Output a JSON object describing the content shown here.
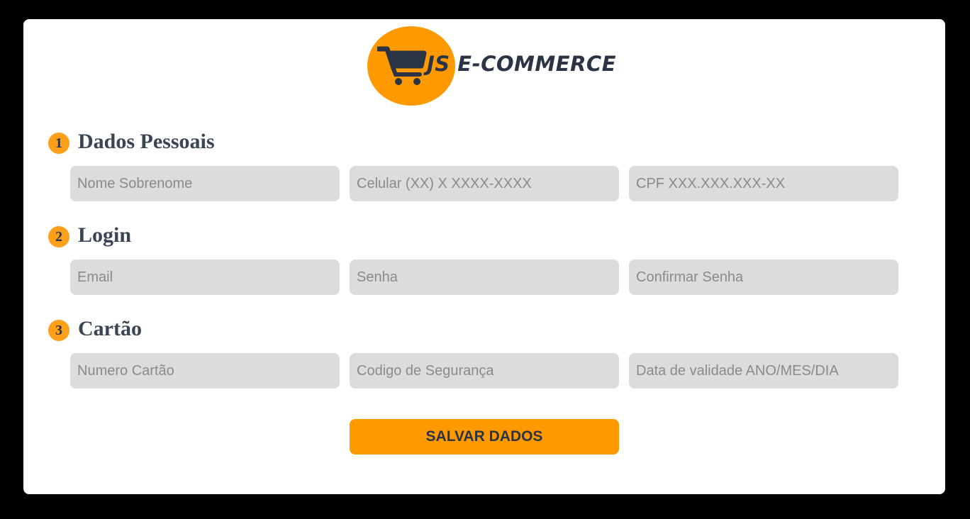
{
  "logo": {
    "text": "JS E-COMMERCE",
    "icon": "shopping-cart-icon",
    "circle_color": "#ff9900",
    "text_color": "#2a3444"
  },
  "sections": [
    {
      "number": "1",
      "title": "Dados Pessoais",
      "fields": [
        {
          "placeholder": "Nome Sobrenome",
          "value": ""
        },
        {
          "placeholder": "Celular (XX) X XXXX-XXXX",
          "value": ""
        },
        {
          "placeholder": "CPF XXX.XXX.XXX-XX",
          "value": ""
        }
      ]
    },
    {
      "number": "2",
      "title": "Login",
      "fields": [
        {
          "placeholder": "Email",
          "value": ""
        },
        {
          "placeholder": "Senha",
          "value": ""
        },
        {
          "placeholder": "Confirmar Senha",
          "value": ""
        }
      ]
    },
    {
      "number": "3",
      "title": "Cartão",
      "fields": [
        {
          "placeholder": "Numero Cartão",
          "value": ""
        },
        {
          "placeholder": "Codigo de Segurança",
          "value": ""
        },
        {
          "placeholder": "Data de validade ANO/MES/DIA",
          "value": ""
        }
      ]
    }
  ],
  "save_button": {
    "label": "SALVAR DADOS",
    "color": "#ff9900"
  },
  "colors": {
    "accent": "#ff9900",
    "field_bg": "#dcdcdc",
    "heading": "#3a4454"
  }
}
